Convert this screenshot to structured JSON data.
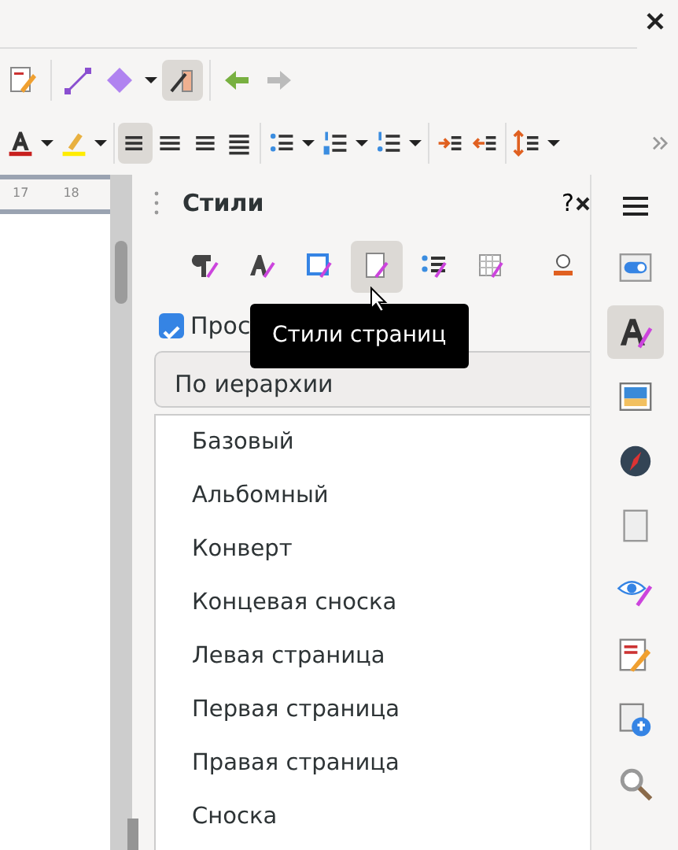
{
  "toolbar_top": [
    {
      "kind": "edit-doc",
      "selected": false
    },
    {
      "kind": "line",
      "selected": false
    },
    {
      "kind": "shape",
      "selected": false
    },
    {
      "kind": "dropdown",
      "selected": false
    },
    {
      "kind": "brush",
      "selected": true
    },
    {
      "kind": "back",
      "selected": false
    },
    {
      "kind": "forward",
      "selected": false
    }
  ],
  "toolbar_format": [
    {
      "kind": "font-color",
      "selected": false
    },
    {
      "kind": "dropdown",
      "selected": false
    },
    {
      "kind": "highlight",
      "selected": false
    },
    {
      "kind": "dropdown",
      "selected": false
    },
    {
      "kind": "align-left",
      "selected": true
    },
    {
      "kind": "align-center",
      "selected": false
    },
    {
      "kind": "align-right",
      "selected": false
    },
    {
      "kind": "justify",
      "selected": false
    },
    {
      "kind": "bullets",
      "selected": false
    },
    {
      "kind": "dropdown",
      "selected": false
    },
    {
      "kind": "numbering",
      "selected": false
    },
    {
      "kind": "dropdown",
      "selected": false
    },
    {
      "kind": "outline",
      "selected": false
    },
    {
      "kind": "dropdown",
      "selected": false
    },
    {
      "kind": "indent",
      "selected": false
    },
    {
      "kind": "outdent",
      "selected": false
    },
    {
      "kind": "spacing",
      "selected": false
    },
    {
      "kind": "dropdown",
      "selected": false
    },
    {
      "kind": "more",
      "selected": false
    }
  ],
  "ruler": [
    "17",
    "18"
  ],
  "styles_panel": {
    "title": "Стили",
    "help": "?",
    "families": [
      {
        "kind": "paragraph",
        "selected": false
      },
      {
        "kind": "character",
        "selected": false
      },
      {
        "kind": "frame",
        "selected": false
      },
      {
        "kind": "page",
        "selected": true
      },
      {
        "kind": "list",
        "selected": false
      },
      {
        "kind": "table",
        "selected": false
      },
      {
        "kind": "fill",
        "selected": false
      }
    ],
    "tooltip": "Стили страниц",
    "preview": {
      "label": "Прос",
      "checked": true
    },
    "filter": "По иерархии",
    "styles": [
      "Базовый",
      "Альбомный",
      "Конверт",
      "Концевая сноска",
      "Левая страница",
      "Первая страница",
      "Правая страница",
      "Сноска"
    ]
  },
  "sidebar": [
    {
      "kind": "properties",
      "selected": false
    },
    {
      "kind": "styles",
      "selected": true
    },
    {
      "kind": "gallery",
      "selected": false
    },
    {
      "kind": "navigator",
      "selected": false
    },
    {
      "kind": "page",
      "selected": false
    },
    {
      "kind": "inspector",
      "selected": false
    },
    {
      "kind": "manage-changes",
      "selected": false
    },
    {
      "kind": "accessibility",
      "selected": false
    },
    {
      "kind": "find",
      "selected": false
    }
  ]
}
